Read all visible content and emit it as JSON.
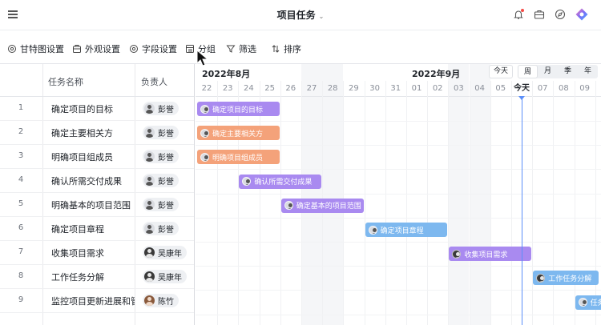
{
  "header": {
    "title": "项目任务",
    "caret": "⌄"
  },
  "toolbar": [
    {
      "label": "甘特图设置",
      "icon": "gear-icon"
    },
    {
      "label": "外观设置",
      "icon": "palette-icon"
    },
    {
      "label": "字段设置",
      "icon": "gear-icon"
    },
    {
      "label": "分组",
      "icon": "group-icon"
    },
    {
      "label": "筛选",
      "icon": "filter-icon"
    },
    {
      "label": "排序",
      "icon": "sort-icon"
    }
  ],
  "table": {
    "col_name": "任务名称",
    "col_owner": "负责人",
    "rows": [
      {
        "num": "1",
        "name": "确定项目的目标",
        "owner": "彭誉"
      },
      {
        "num": "2",
        "name": "确定主要相关方",
        "owner": "彭誉"
      },
      {
        "num": "3",
        "name": "明确项目组成员",
        "owner": "彭誉"
      },
      {
        "num": "4",
        "name": "确认所需交付成果",
        "owner": "彭誉"
      },
      {
        "num": "5",
        "name": "明确基本的项目范围",
        "owner": "彭誉"
      },
      {
        "num": "6",
        "name": "确定项目章程",
        "owner": "彭誉"
      },
      {
        "num": "7",
        "name": "收集项目需求",
        "owner": "吴康年"
      },
      {
        "num": "8",
        "name": "工作任务分解",
        "owner": "吴康年"
      },
      {
        "num": "9",
        "name": "监控项目更新进展和管",
        "owner": "陈竹"
      }
    ]
  },
  "timeline": {
    "month1": "2022年8月",
    "month2": "2022年9月",
    "today_btn": "今天",
    "scales": [
      "周",
      "月",
      "季",
      "年"
    ],
    "active_scale": "周",
    "days": [
      "22",
      "23",
      "24",
      "25",
      "26",
      "27",
      "28",
      "29",
      "30",
      "31",
      "01",
      "02",
      "03",
      "04",
      "05",
      "今天",
      "07",
      "08",
      "09"
    ],
    "bars": [
      {
        "label": "确定项目的目标",
        "color": "#a98af0"
      },
      {
        "label": "确定主要相关方",
        "color": "#f4a27a"
      },
      {
        "label": "明确项目组成员",
        "color": "#f4a27a"
      },
      {
        "label": "确认所需交付成果",
        "color": "#a98af0"
      },
      {
        "label": "确定基本的项目范围",
        "color": "#a98af0"
      },
      {
        "label": "确定项目章程",
        "color": "#7db8ef"
      },
      {
        "label": "收集项目需求",
        "color": "#a98af0"
      },
      {
        "label": "工作任务分解",
        "color": "#7db8ef"
      },
      {
        "label": "任务",
        "color": "#7db8ef"
      }
    ]
  }
}
